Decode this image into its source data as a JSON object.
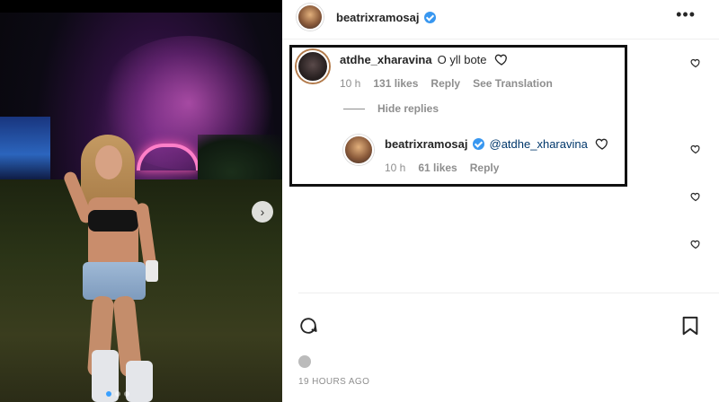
{
  "post": {
    "username": "beatrixramosaj",
    "more_icon": "more-horizontal-icon",
    "timestamp": "19 HOURS AGO",
    "carousel_next_icon": "chevron-right-icon"
  },
  "comment": {
    "username": "atdhe_xharavina",
    "text": "O yll bote",
    "time": "10 h",
    "likes": "131 likes",
    "reply_label": "Reply",
    "translate_label": "See Translation",
    "like_icon": "heart-outline-icon"
  },
  "replies_toggle": {
    "label": "Hide replies"
  },
  "reply": {
    "username": "beatrixramosaj",
    "mention": "@atdhe_xharavina",
    "time": "10 h",
    "likes": "61 likes",
    "reply_label": "Reply",
    "like_icon": "heart-outline-icon"
  },
  "colors": {
    "verified": "#3897f0",
    "mention": "#00376b",
    "meta_gray": "#8e8e8e",
    "highlight_border": "#111111"
  }
}
